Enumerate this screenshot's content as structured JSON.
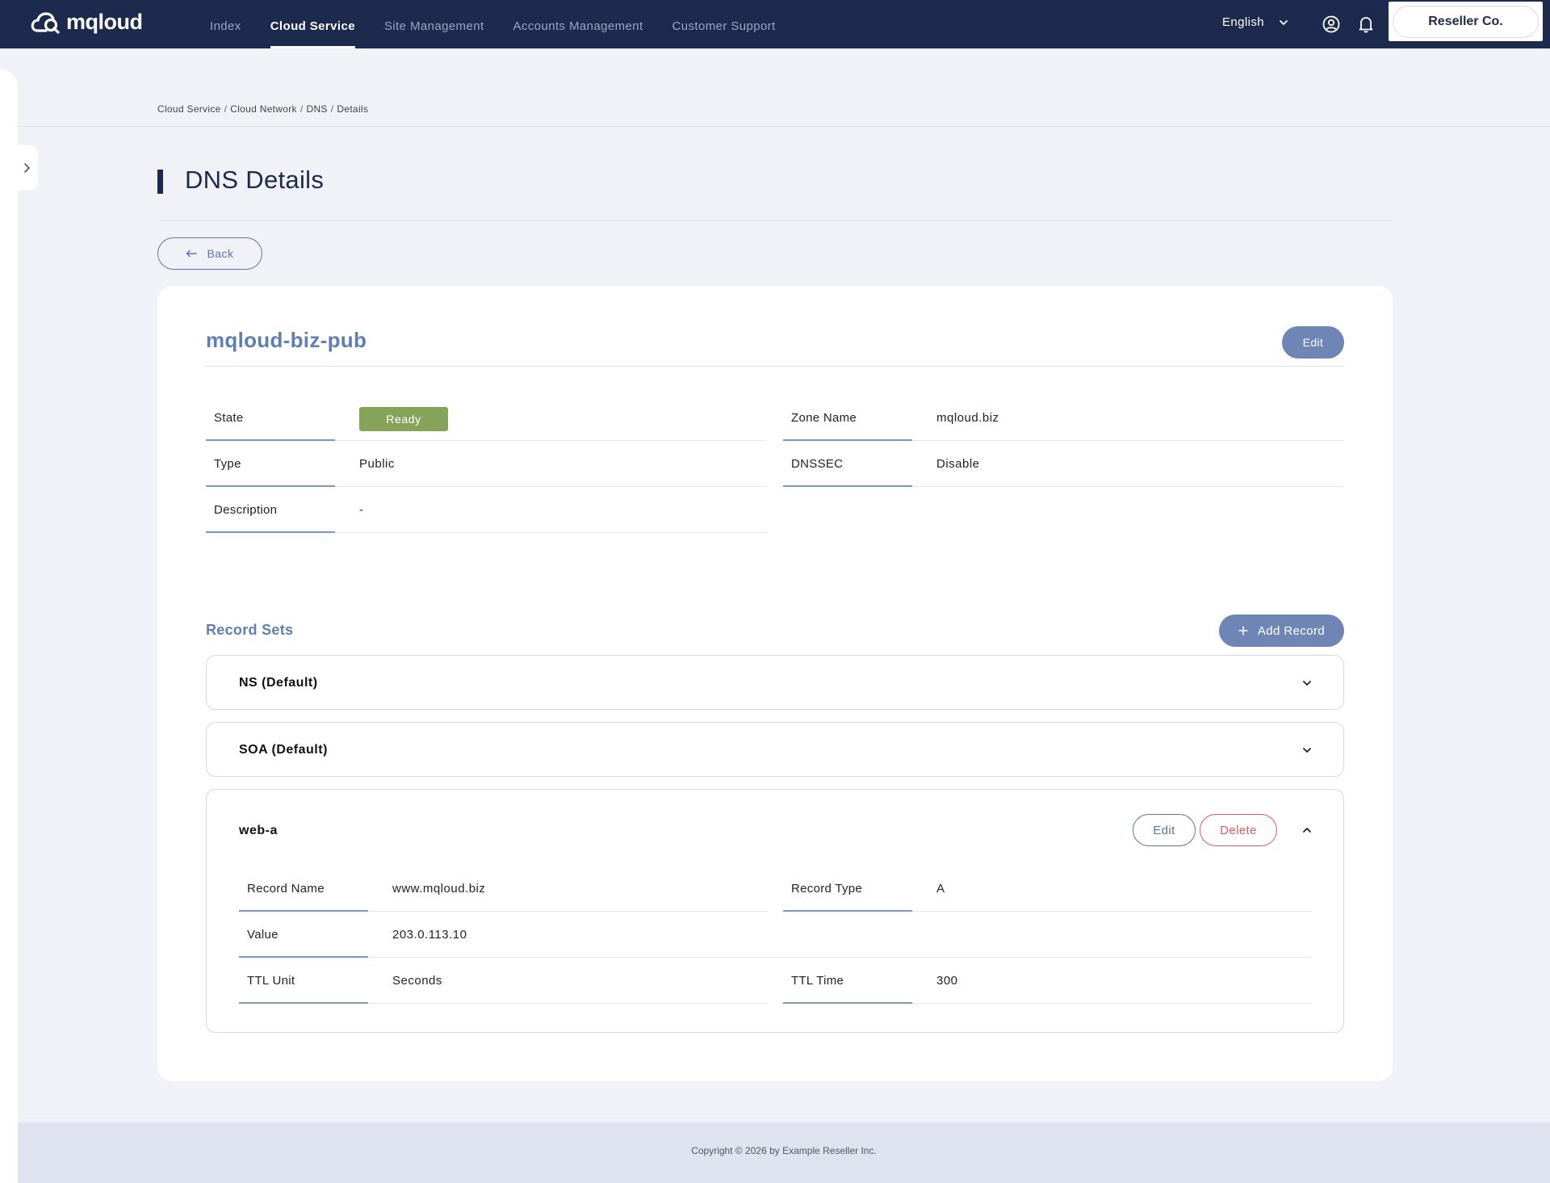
{
  "brand": {
    "name": "mqloud"
  },
  "nav": {
    "items": [
      {
        "label": "Index",
        "active": false
      },
      {
        "label": "Cloud Service",
        "active": true
      },
      {
        "label": "Site Management",
        "active": false
      },
      {
        "label": "Accounts Management",
        "active": false
      },
      {
        "label": "Customer Support",
        "active": false
      }
    ],
    "language": "English",
    "reseller": "Reseller Co."
  },
  "breadcrumb": [
    "Cloud Service",
    "Cloud Network",
    "DNS",
    "Details"
  ],
  "page": {
    "title": "DNS Details",
    "back_label": "Back"
  },
  "dns": {
    "name": "mqloud-biz-pub",
    "edit_label": "Edit",
    "fields": {
      "state": {
        "label": "State",
        "value": "Ready"
      },
      "zone_name": {
        "label": "Zone Name",
        "value": "mqloud.biz"
      },
      "type": {
        "label": "Type",
        "value": "Public"
      },
      "dnssec": {
        "label": "DNSSEC",
        "value": "Disable"
      },
      "description": {
        "label": "Description",
        "value": "-"
      }
    }
  },
  "record_sets": {
    "title": "Record Sets",
    "add_label": "Add Record",
    "items": [
      {
        "title": "NS (Default)",
        "expanded": false
      },
      {
        "title": "SOA (Default)",
        "expanded": false
      },
      {
        "title": "web-a",
        "expanded": true,
        "edit_label": "Edit",
        "delete_label": "Delete",
        "fields": {
          "record_name": {
            "label": "Record Name",
            "value": "www.mqloud.biz"
          },
          "record_type": {
            "label": "Record Type",
            "value": "A"
          },
          "value": {
            "label": "Value",
            "value": "203.0.113.10"
          },
          "ttl_unit": {
            "label": "TTL Unit",
            "value": "Seconds"
          },
          "ttl_time": {
            "label": "TTL Time",
            "value": "300"
          }
        }
      }
    ]
  },
  "footer": {
    "copyright": "Copyright © 2026 by Example Reseller Inc."
  },
  "colors": {
    "nav_bg": "#1c2a4d",
    "accent": "#6e85b5",
    "heading_blue": "#5f7eb1",
    "ready_green": "#86a35a",
    "delete_red": "#e05a5a"
  }
}
